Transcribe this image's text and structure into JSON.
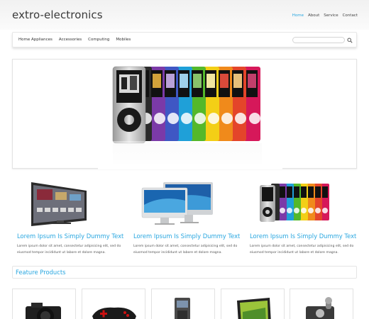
{
  "site": {
    "logo": "extro-electronics"
  },
  "top_nav": {
    "items": [
      "Home",
      "About",
      "Service",
      "Contact"
    ],
    "active": "Home"
  },
  "main_menu": {
    "items": [
      "Home Appliances",
      "Accessories",
      "Computing",
      "Mobiles"
    ]
  },
  "search": {
    "placeholder": ""
  },
  "products": [
    {
      "title": "Lorem Ipsum Is Simply Dummy Text",
      "desc": "Lorem ipsum dolor sit amet, consectetur adipisicing elit, sed do eiusmod tempor incididunt ut labore et dolore magna."
    },
    {
      "title": "Lorem Ipsum Is Simply Dummy Text",
      "desc": "Lorem ipsum dolor sit amet, consectetur adipisicing elit, sed do eiusmod tempor incididunt ut labore et dolore magna."
    },
    {
      "title": "Lorem Ipsum Is Simply Dummy Text",
      "desc": "Lorem ipsum dolor sit amet, consectetur adipisicing elit, sed do eiusmod tempor incididunt ut labore et dolore magna."
    }
  ],
  "featured": {
    "title": "Feature Products"
  },
  "colors": {
    "accent": "#2aa7e0",
    "text": "#333333"
  }
}
